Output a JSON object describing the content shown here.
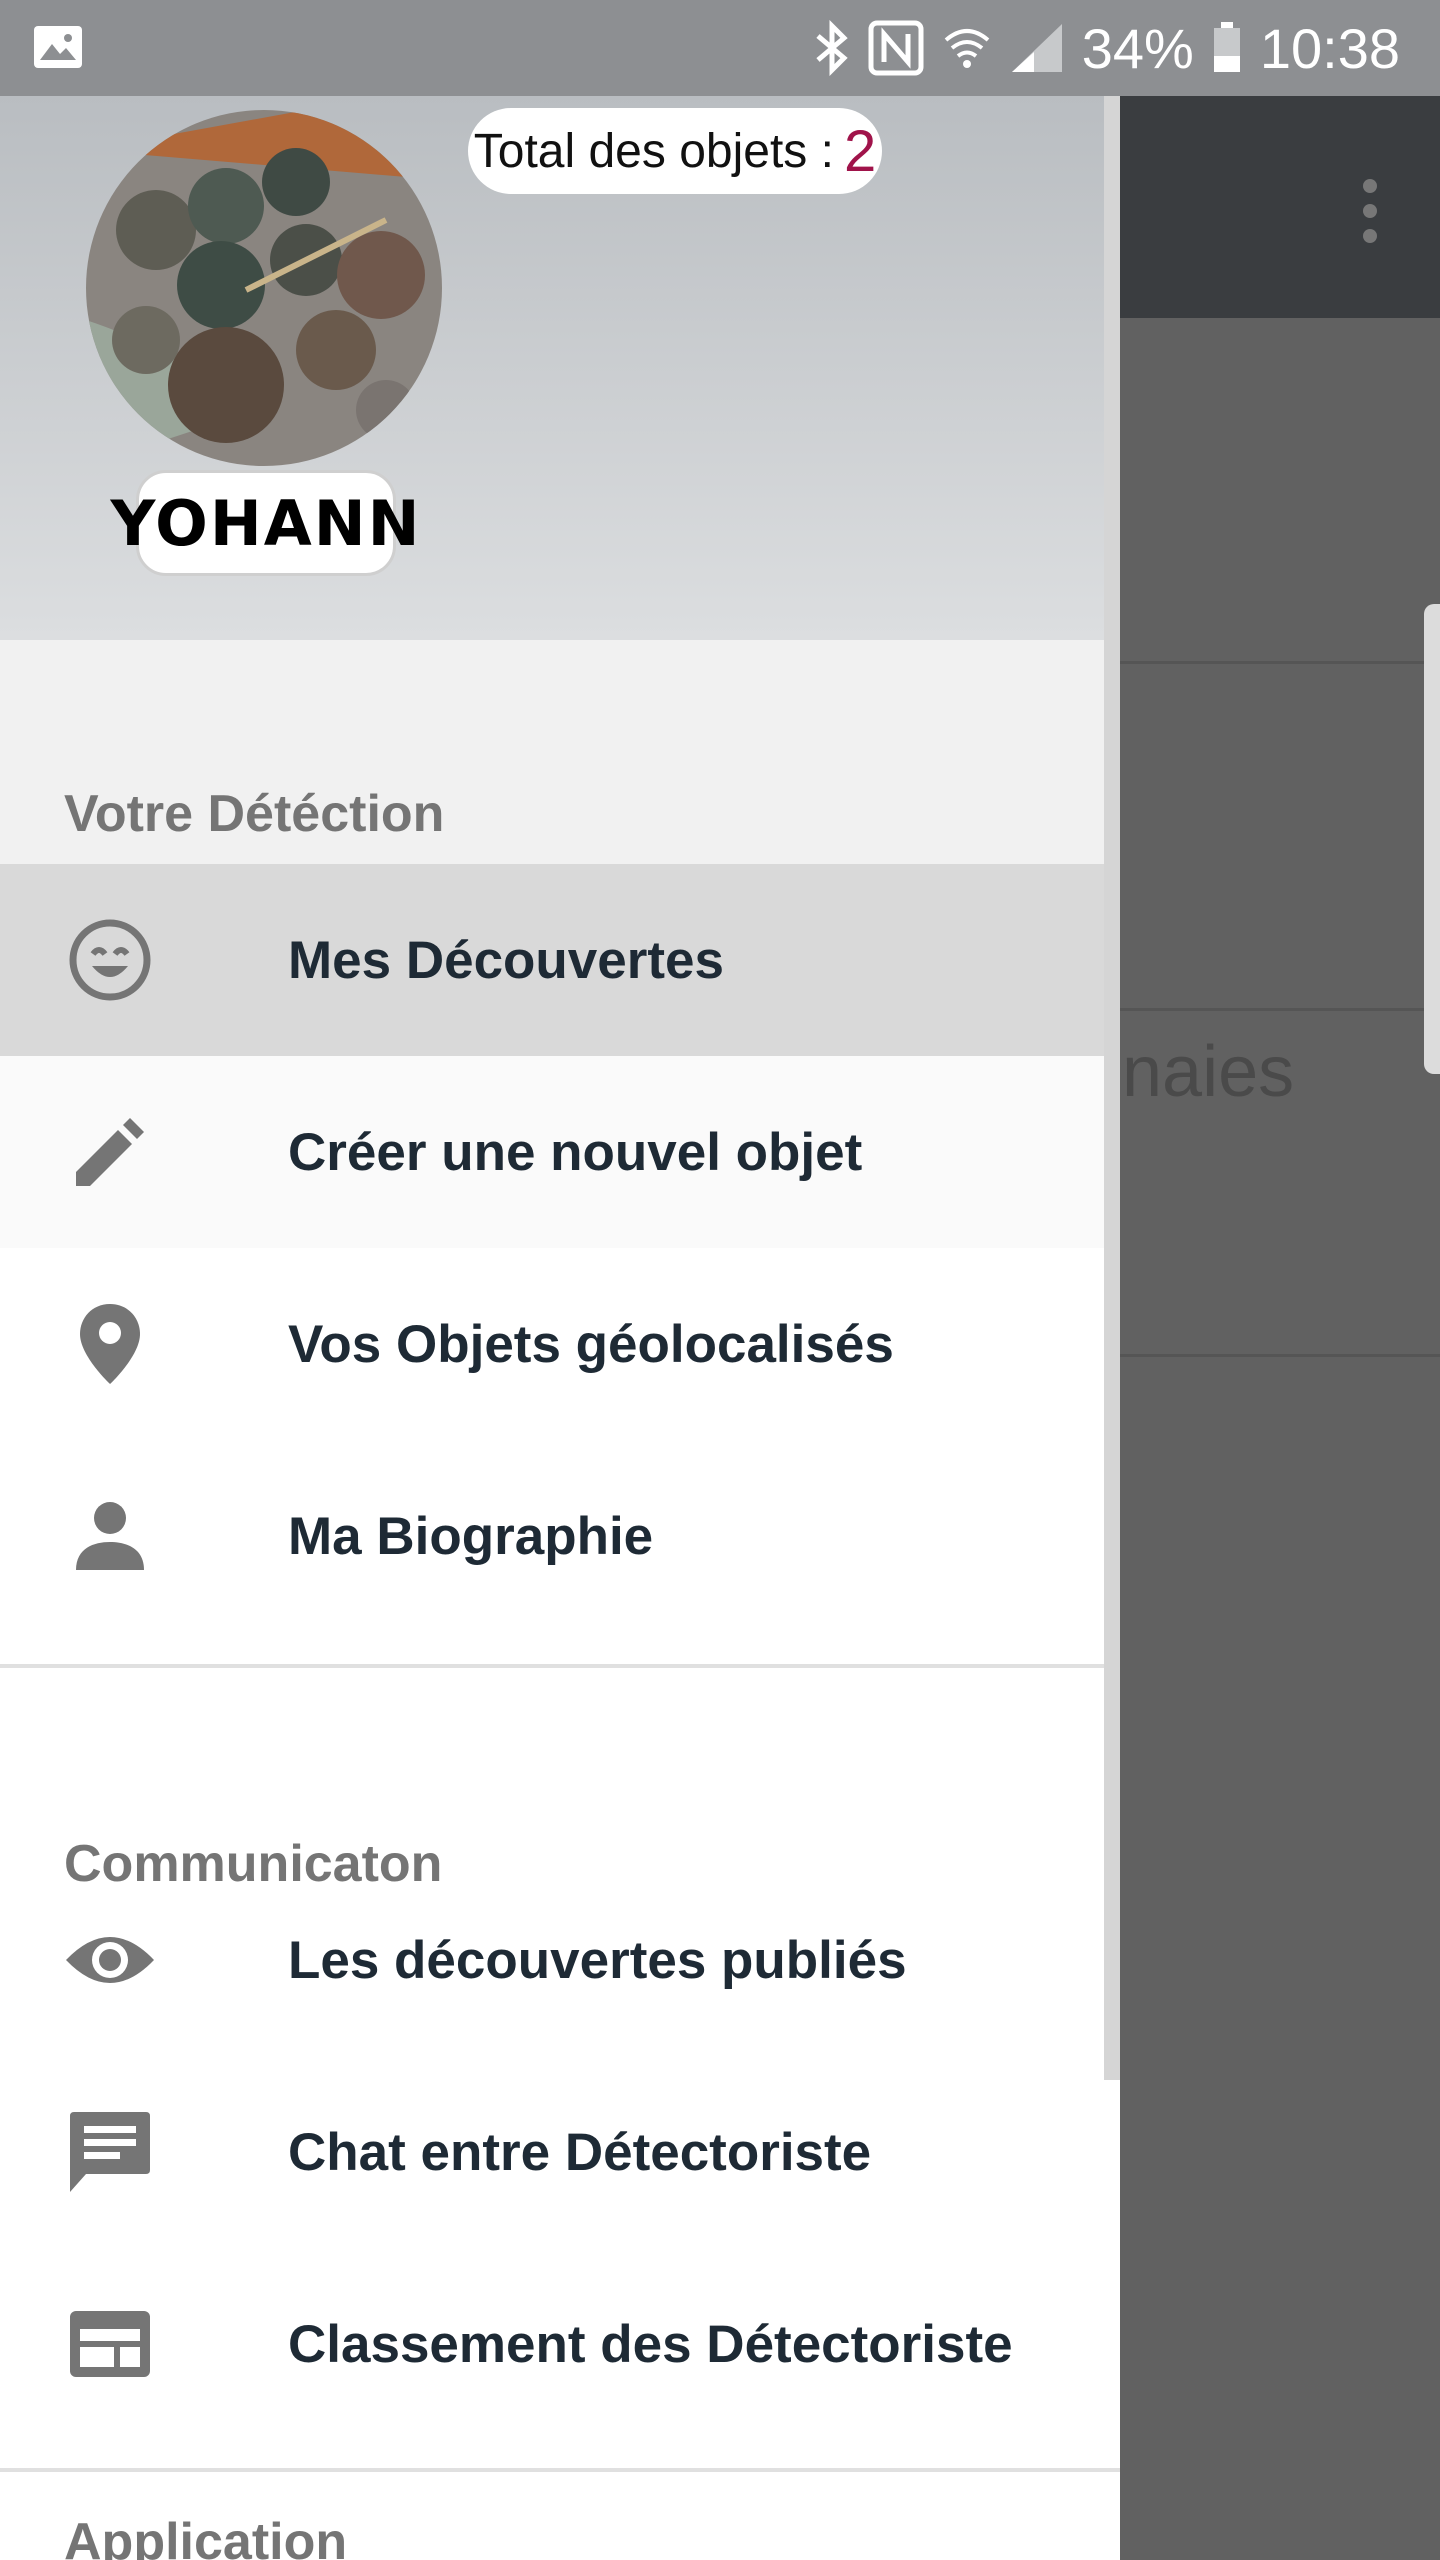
{
  "status_bar": {
    "battery": "34%",
    "time": "10:38"
  },
  "background": {
    "partial_text": "naies"
  },
  "drawer": {
    "header": {
      "total_label": "Total des objets :",
      "total_count": "2",
      "user_name": "YOHANN"
    },
    "sections": [
      {
        "title": "Votre Détéction",
        "items": [
          {
            "label": "Mes Découvertes",
            "icon": "smiley-icon"
          },
          {
            "label": "Créer une nouvel objet",
            "icon": "pencil-icon"
          },
          {
            "label": "Vos Objets géolocalisés",
            "icon": "location-pin-icon"
          },
          {
            "label": "Ma Biographie",
            "icon": "person-icon"
          }
        ]
      },
      {
        "title": "Communicaton",
        "items": [
          {
            "label": "Les découvertes publiés",
            "icon": "eye-icon"
          },
          {
            "label": "Chat entre Détectoriste",
            "icon": "chat-icon"
          },
          {
            "label": "Classement des Détectoriste",
            "icon": "web-layout-icon"
          }
        ]
      },
      {
        "title": "Application"
      }
    ]
  },
  "colors": {
    "accent_count": "#a0134a",
    "label_text": "#1e2a35",
    "section_text": "#757575",
    "active_row": "#d9d9d9"
  }
}
